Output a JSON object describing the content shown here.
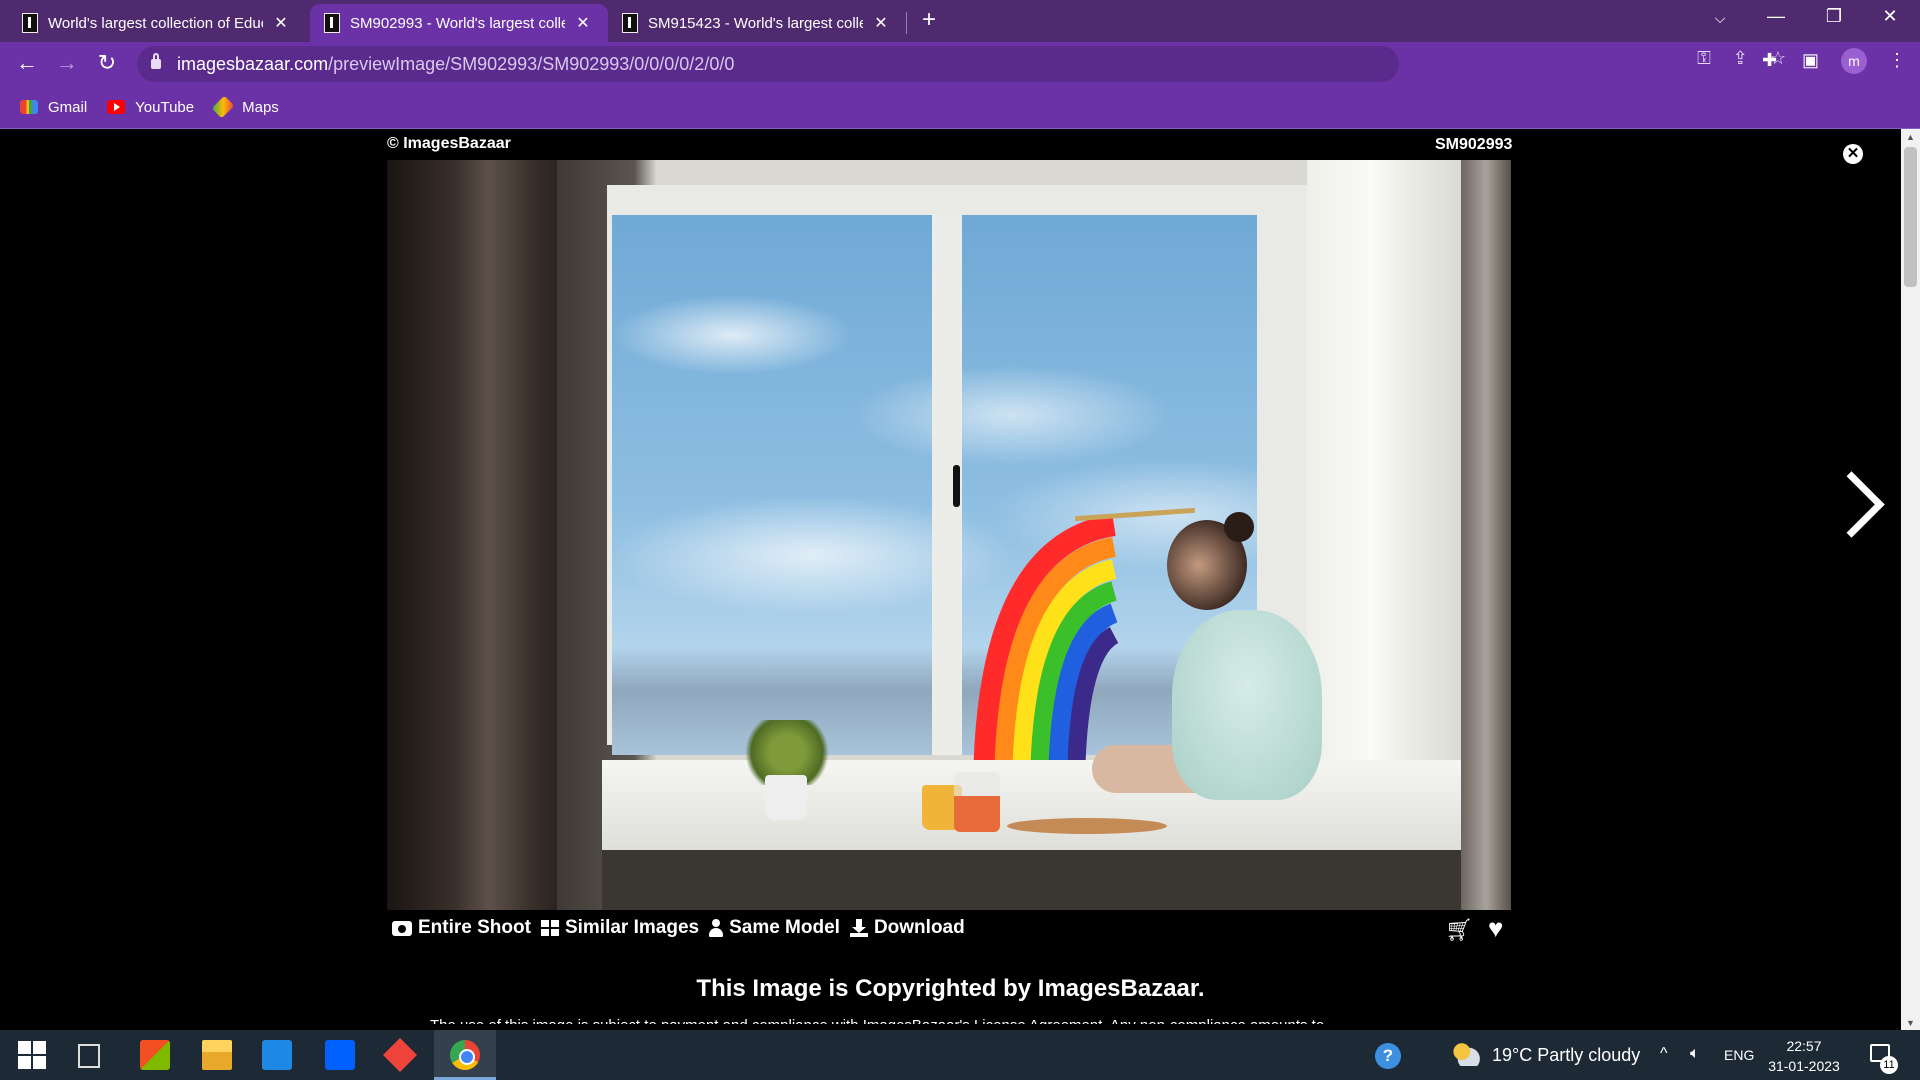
{
  "browser": {
    "tabs": [
      {
        "title": "World's largest collection of Educ",
        "active": false
      },
      {
        "title": "SM902993 - World's largest colle",
        "active": true
      },
      {
        "title": "SM915423 - World's largest colle",
        "active": false
      }
    ],
    "new_tab_icon": "plus-icon",
    "url_host": "imagesbazaar.com",
    "url_path": "/previewImage/SM902993/SM902993/0/0/0/0/2/0/0",
    "profile_initial": "m",
    "bookmarks": [
      {
        "label": "Gmail",
        "icon": "gmail-icon"
      },
      {
        "label": "YouTube",
        "icon": "youtube-icon"
      },
      {
        "label": "Maps",
        "icon": "maps-icon"
      }
    ],
    "accent_color": "#6a32a6"
  },
  "preview": {
    "credit": "© ImagesBazaar",
    "image_id": "SM902993",
    "actions": [
      {
        "label": "Entire Shoot",
        "icon": "camera-icon"
      },
      {
        "label": "Similar Images",
        "icon": "grid-icon"
      },
      {
        "label": "Same Model",
        "icon": "person-icon"
      },
      {
        "label": "Download",
        "icon": "download-icon"
      }
    ],
    "copyright_heading": "This Image is Copyrighted by ImagesBazaar.",
    "license_text": "The use of this image is subject to payment and compliance with ImagesBazaar's License Agreement. Any non-compliance amounts to"
  },
  "taskbar": {
    "weather_temp": "19°C",
    "weather_desc": "Partly cloudy",
    "language": "ENG",
    "time": "22:57",
    "date": "31-01-2023",
    "notification_count": "11"
  }
}
